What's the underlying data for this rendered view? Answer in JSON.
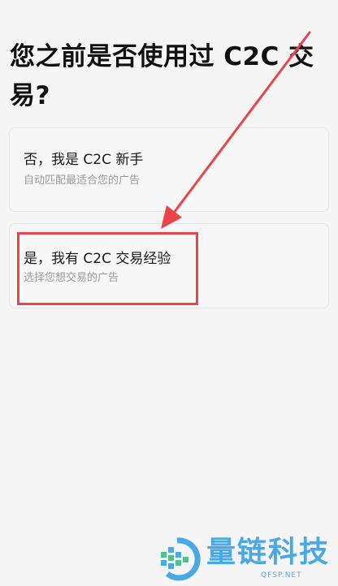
{
  "page": {
    "title": "您之前是否使用过 C2C 交易?"
  },
  "options": [
    {
      "title": "否，我是 C2C 新手",
      "subtitle": "自动匹配最适合您的广告"
    },
    {
      "title": "是，我有 C2C 交易经验",
      "subtitle": "选择您想交易的广告"
    }
  ],
  "annotation": {
    "color": "#e8454b"
  },
  "watermark": {
    "name": "量链科技",
    "domain": "QFSP.NET",
    "color": "#4aa8e6"
  },
  "colors": {
    "background": "#f5f5f5",
    "card": "#f7f7f7",
    "title_text": "#111111",
    "subtitle_text": "#9a9a9a"
  }
}
